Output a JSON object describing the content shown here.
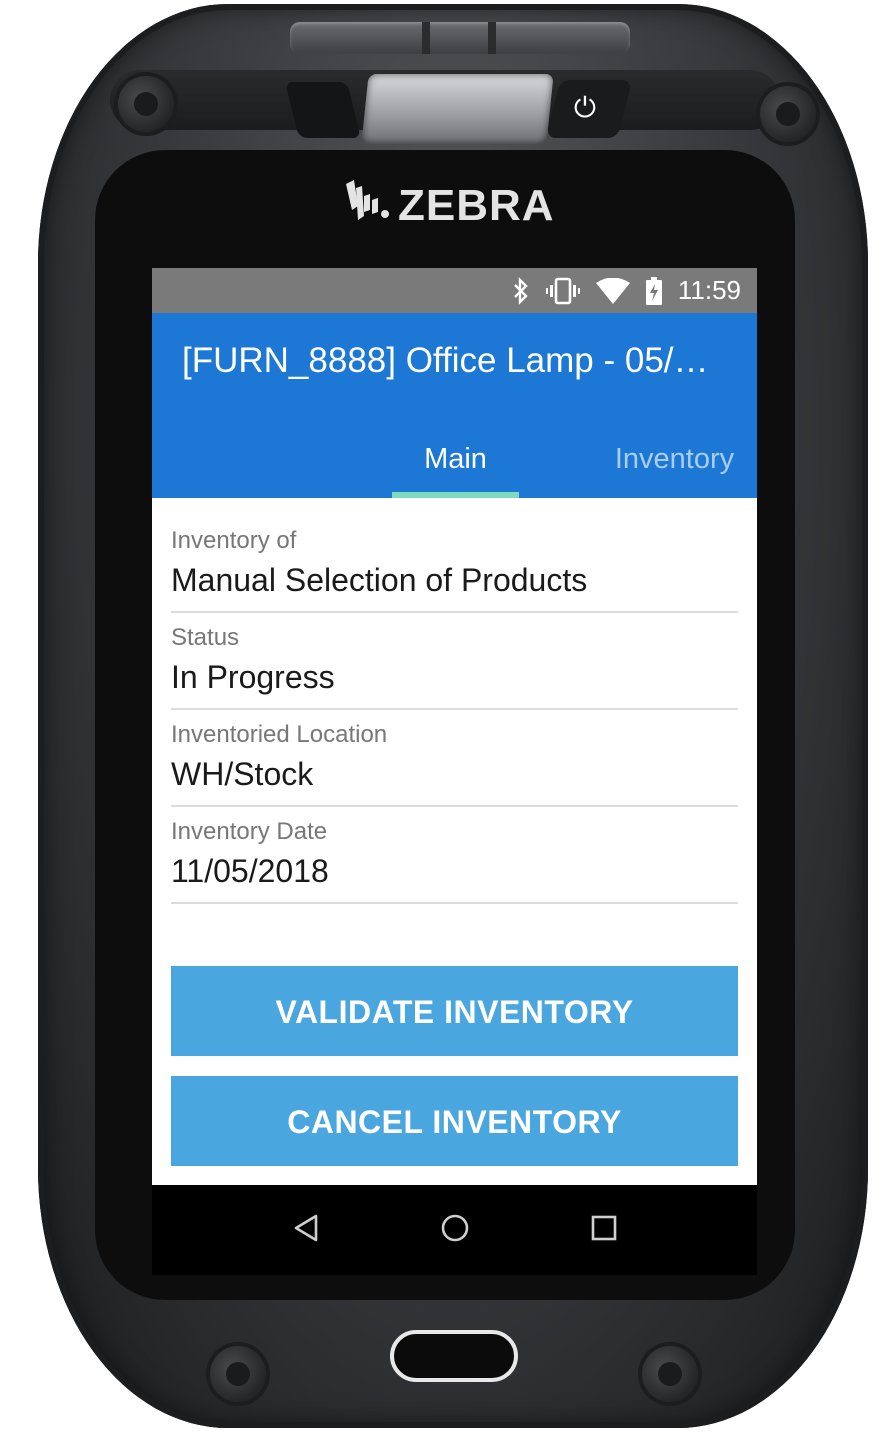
{
  "device": {
    "brand": "ZEBRA",
    "icons": [
      "power-icon",
      "zebra-logo-icon"
    ]
  },
  "status_bar": {
    "time": "11:59",
    "icons": [
      "bluetooth-icon",
      "vibrate-icon",
      "wifi-icon",
      "battery-charging-icon"
    ]
  },
  "app_bar": {
    "title": "[FURN_8888] Office Lamp - 05/…",
    "color": "#1c78d4",
    "tabs": [
      {
        "label": "Main",
        "selected": true
      },
      {
        "label": "Inventory",
        "selected": false
      }
    ],
    "indicator_color": "#7ddcbf"
  },
  "fields": [
    {
      "label": "Inventory of",
      "value": "Manual Selection of Products"
    },
    {
      "label": "Status",
      "value": "In Progress"
    },
    {
      "label": "Inventoried Location",
      "value": "WH/Stock"
    },
    {
      "label": "Inventory Date",
      "value": "11/05/2018"
    }
  ],
  "actions": {
    "validate_label": "VALIDATE INVENTORY",
    "cancel_label": "CANCEL INVENTORY",
    "button_color": "#4aa6df"
  },
  "nav_bar": {
    "icons": [
      "back-icon",
      "home-icon",
      "recents-icon"
    ]
  }
}
